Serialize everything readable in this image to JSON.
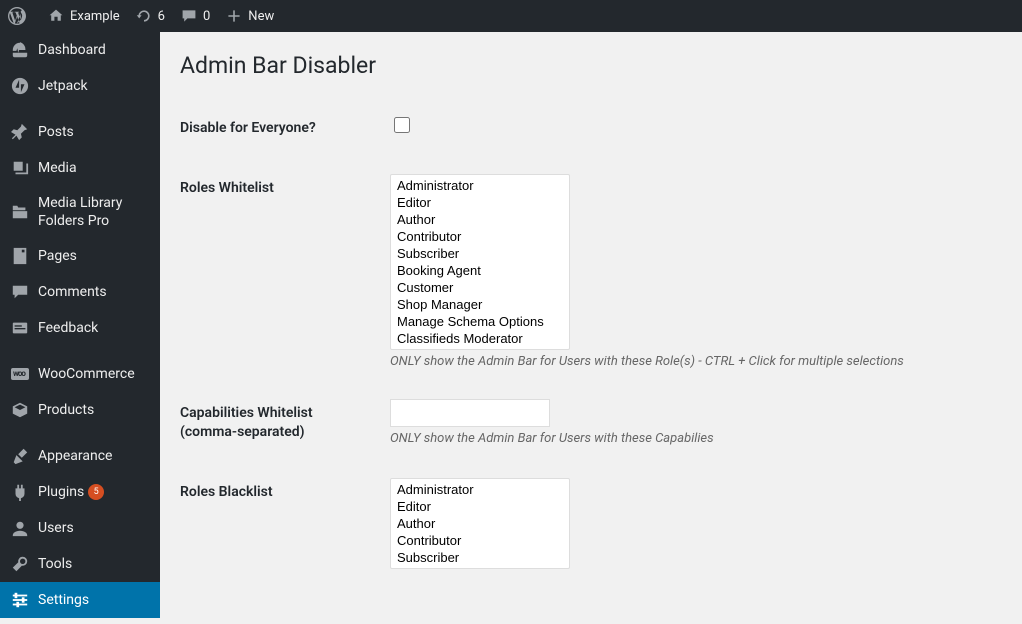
{
  "adminbar": {
    "site_name": "Example",
    "updates_count": "6",
    "comments_count": "0",
    "new_label": "New"
  },
  "sidebar": {
    "items": [
      {
        "label": "Dashboard"
      },
      {
        "label": "Jetpack"
      },
      {
        "label": "Posts"
      },
      {
        "label": "Media"
      },
      {
        "label": "Media Library Folders Pro"
      },
      {
        "label": "Pages"
      },
      {
        "label": "Comments"
      },
      {
        "label": "Feedback"
      },
      {
        "label": "WooCommerce"
      },
      {
        "label": "Products"
      },
      {
        "label": "Appearance"
      },
      {
        "label": "Plugins",
        "badge": "5"
      },
      {
        "label": "Users"
      },
      {
        "label": "Tools"
      },
      {
        "label": "Settings"
      }
    ]
  },
  "page": {
    "title": "Admin Bar Disabler",
    "disable_everyone_label": "Disable for Everyone?",
    "roles_whitelist_label": "Roles Whitelist",
    "roles_whitelist_help": "ONLY show the Admin Bar for Users with these Role(s) - CTRL + Click for multiple selections",
    "caps_whitelist_label": "Capabilities Whitelist (comma-separated)",
    "caps_whitelist_help": "ONLY show the Admin Bar for Users with these Capabilies",
    "roles_blacklist_label": "Roles Blacklist",
    "roles_whitelist_options": [
      "Administrator",
      "Editor",
      "Author",
      "Contributor",
      "Subscriber",
      "Booking Agent",
      "Customer",
      "Shop Manager",
      "Manage Schema Options",
      "Classifieds Moderator"
    ],
    "roles_blacklist_options": [
      "Administrator",
      "Editor",
      "Author",
      "Contributor",
      "Subscriber"
    ],
    "caps_whitelist_value": ""
  }
}
